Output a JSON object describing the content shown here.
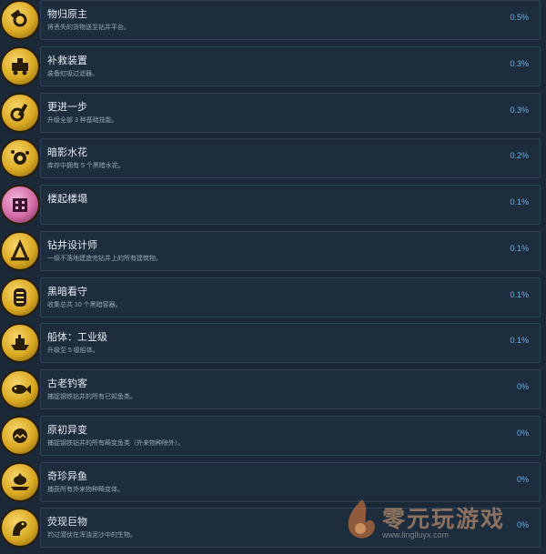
{
  "achievements": [
    {
      "title": "物归原主",
      "desc": "将丢失的货物送至钻井平台。",
      "pct": "0.5%",
      "icon": "hammer-gear-icon",
      "tint": "gold"
    },
    {
      "title": "补救装置",
      "desc": "装备虹吸过滤器。",
      "pct": "0.3%",
      "icon": "machine-icon",
      "tint": "gold"
    },
    {
      "title": "更进一步",
      "desc": "升级全部 3 种基础技能。",
      "pct": "0.3%",
      "icon": "tools-icon",
      "tint": "gold"
    },
    {
      "title": "暗影水花",
      "desc": "库存中拥有 5 个黑暗水花。",
      "pct": "0.2%",
      "icon": "splash-icon",
      "tint": "gold"
    },
    {
      "title": "楼起楼塌",
      "desc": "",
      "pct": "0.1%",
      "icon": "building-icon",
      "tint": "pink"
    },
    {
      "title": "钻井设计师",
      "desc": "一级不落地建造完钻井上的所有建筑物。",
      "pct": "0.1%",
      "icon": "crane-icon",
      "tint": "gold"
    },
    {
      "title": "黑暗看守",
      "desc": "收集总共 10 个黑暗容器。",
      "pct": "0.1%",
      "icon": "container-icon",
      "tint": "gold"
    },
    {
      "title": "船体：工业级",
      "desc": "升级至 5 级船体。",
      "pct": "0.1%",
      "icon": "ship-icon",
      "tint": "gold"
    },
    {
      "title": "古老钓客",
      "desc": "捕捉钢铁钻井的所有已知鱼类。",
      "pct": "0%",
      "icon": "fish-icon",
      "tint": "gold"
    },
    {
      "title": "原初异变",
      "desc": "捕捉钢铁钻井的所有畸变鱼类（外来物种除外）。",
      "pct": "0%",
      "icon": "mutant-fish-icon",
      "tint": "gold"
    },
    {
      "title": "奇珍异鱼",
      "desc": "捕获所有外来物种畸变体。",
      "pct": "0%",
      "icon": "exotic-fish-icon",
      "tint": "gold"
    },
    {
      "title": "荧现巨物",
      "desc": "钓过潜伏在浑浊泥沙中的生物。",
      "pct": "0%",
      "icon": "sea-monster-icon",
      "tint": "gold"
    }
  ],
  "watermark": {
    "text": "零元玩游戏",
    "url": "www.linglluyx.com"
  }
}
